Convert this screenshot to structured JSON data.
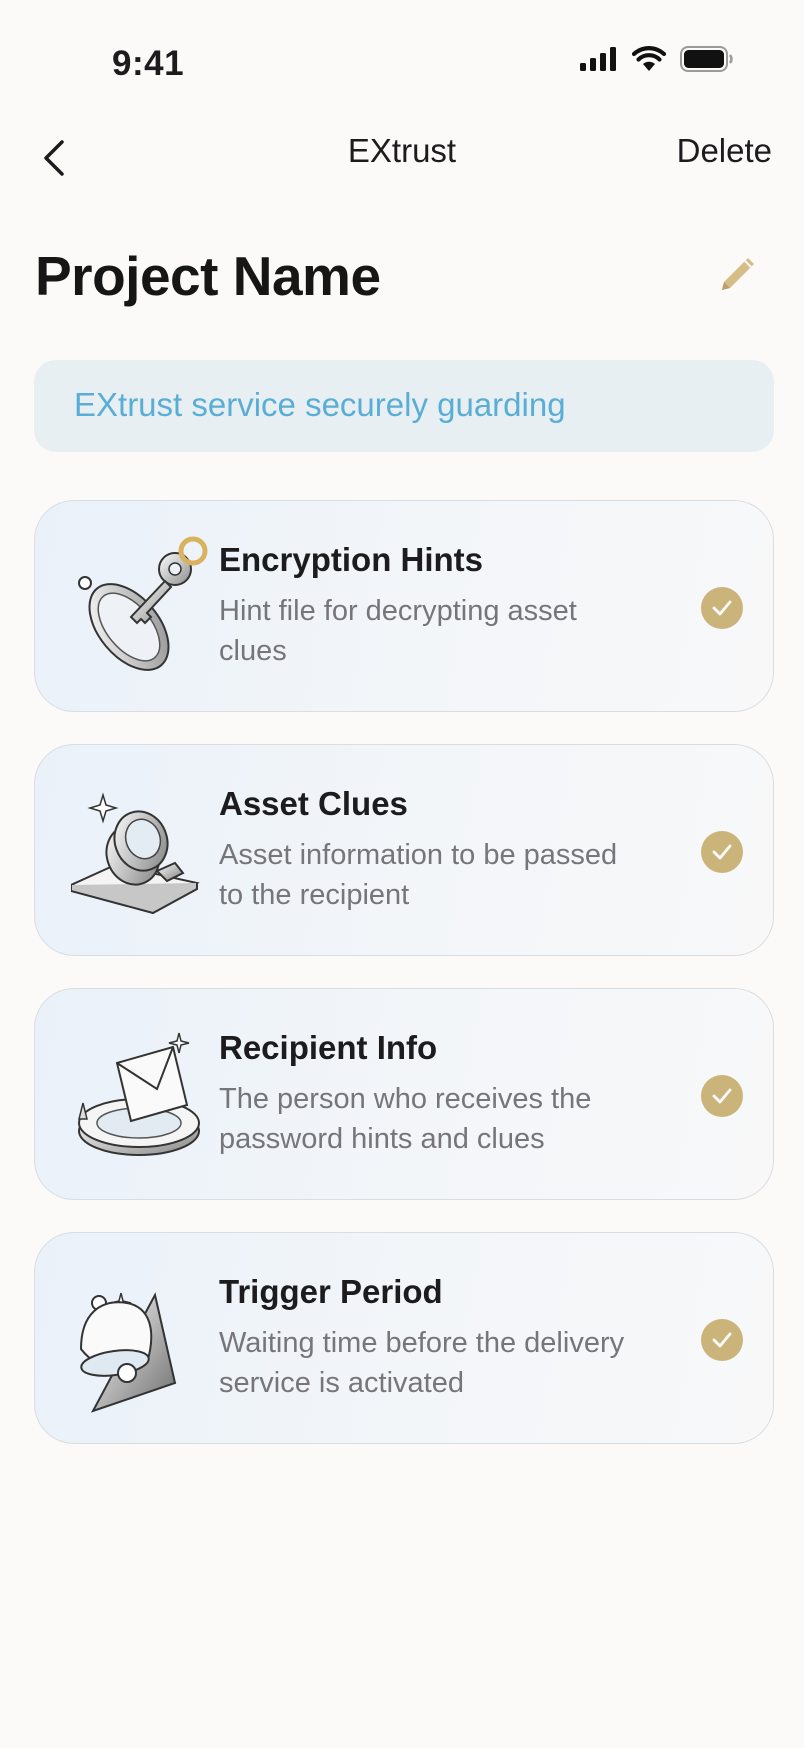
{
  "status_bar": {
    "time": "9:41"
  },
  "nav": {
    "title": "EXtrust",
    "delete_label": "Delete"
  },
  "page": {
    "title": "Project Name"
  },
  "banner": {
    "text": "EXtrust service securely guarding"
  },
  "colors": {
    "accent_gold": "#cbb47a",
    "banner_text": "#5aaed6",
    "banner_bg": "#e7eff2"
  },
  "cards": [
    {
      "title": "Encryption Hints",
      "desc": "Hint file for decrypting asset clues",
      "icon": "key-icon",
      "completed": true
    },
    {
      "title": "Asset Clues",
      "desc": "Asset information to be passed to the recipient",
      "icon": "magnifier-icon",
      "completed": true
    },
    {
      "title": "Recipient Info",
      "desc": "The person who receives the password hints and clues",
      "icon": "envelope-icon",
      "completed": true
    },
    {
      "title": "Trigger Period",
      "desc": "Waiting time before the delivery service is activated",
      "icon": "bell-icon",
      "completed": true
    }
  ]
}
